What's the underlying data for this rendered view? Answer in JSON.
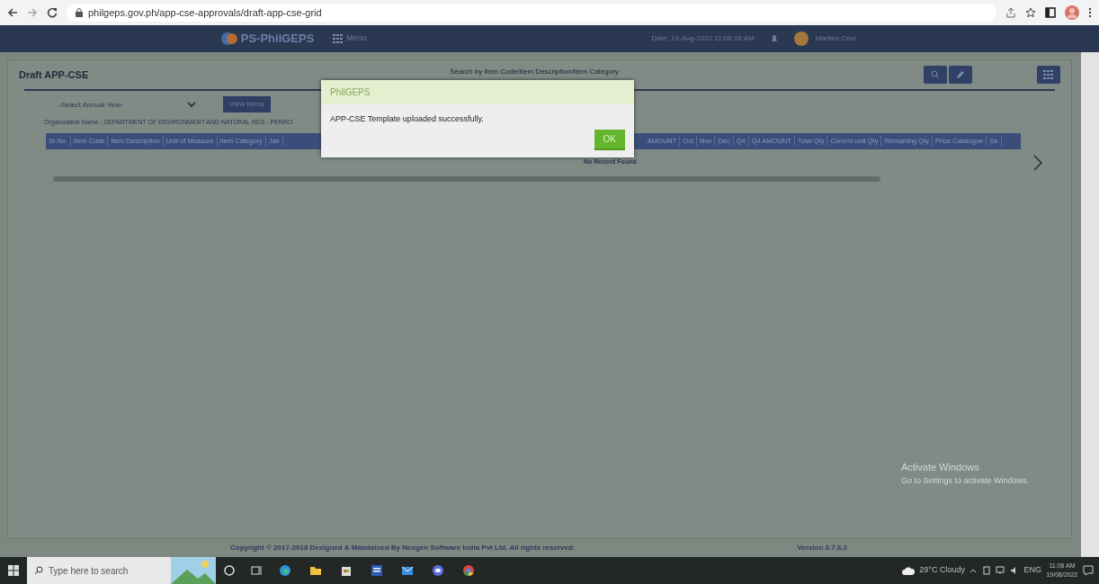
{
  "browser": {
    "url": "philgeps.gov.ph/app-cse-approvals/draft-app-cse-grid"
  },
  "header": {
    "logo_text": "PS-PhilGEPS",
    "menu_label": "Menu",
    "datetime": "Date: 19-Aug-2022 11:06:16 AM",
    "user_name": "Marites Cruz"
  },
  "page": {
    "title": "Draft APP-CSE",
    "search_placeholder": "Search by Item Code/Item Description/Item Category",
    "year_select": {
      "placeholder": "-Select Annual Year-"
    },
    "view_button": "View Items",
    "organization": "Organization Name : DEPARTMENT OF ENVIRONMENT AND NATURAL RES - PENRO",
    "columns_left": [
      "Sr.No.",
      "Item Code",
      "Item Description",
      "Unit of Measure",
      "Item Category",
      "Jan"
    ],
    "columns_right": [
      "AMOUNT",
      "Oct",
      "Nov",
      "Dec",
      "Q4",
      "Q4 AMOUNT",
      "Total Qty",
      "Current unit Qty",
      "Remaining Qty",
      "Price Catalogue",
      "Se"
    ],
    "empty_message": "No Record Found"
  },
  "dialog": {
    "title": "PhilGEPS",
    "message": "APP-CSE Template uploaded successfully.",
    "button": "OK"
  },
  "footer": {
    "copyright": "Copyright © 2017-2018 Designed & Maintained By Nexgen Software India Pvt Ltd. All rights reserved.",
    "version": "Version 3.7.6.2"
  },
  "watermark": {
    "title": "Activate Windows",
    "subtitle": "Go to Settings to activate Windows."
  },
  "taskbar": {
    "search_placeholder": "Type here to search",
    "weather": "29°C Cloudy",
    "language": "ENG",
    "time": "11:06 AM",
    "date": "19/08/2022"
  }
}
